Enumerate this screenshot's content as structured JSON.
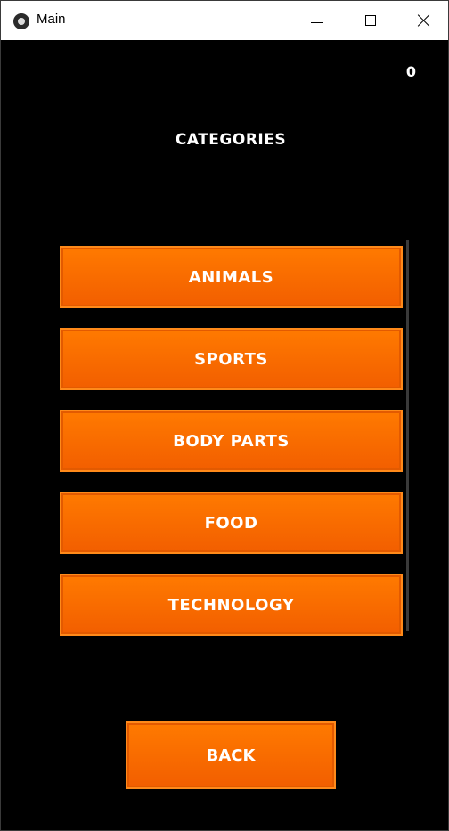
{
  "window": {
    "title": "Main"
  },
  "header": {
    "score": "0",
    "heading": "CATEGORIES"
  },
  "categories": [
    {
      "label": "ANIMALS"
    },
    {
      "label": "SPORTS"
    },
    {
      "label": "BODY PARTS"
    },
    {
      "label": "FOOD"
    },
    {
      "label": "TECHNOLOGY"
    }
  ],
  "footer": {
    "back_label": "BACK"
  },
  "colors": {
    "button": "#ff6d00",
    "button_border": "#ff8a1a",
    "background": "#000000",
    "text": "#ffffff"
  }
}
